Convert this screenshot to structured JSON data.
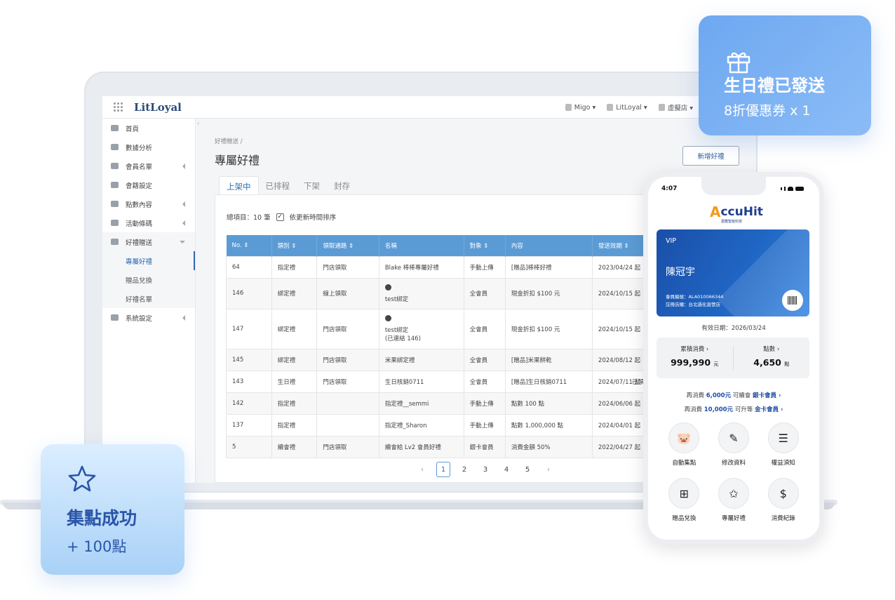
{
  "app": {
    "brand": "LitLoyal"
  },
  "topbar": {
    "items": [
      {
        "label": "Migo ▾",
        "icon": "building-icon"
      },
      {
        "label": "LitLoyal ▾",
        "icon": "star-icon"
      },
      {
        "label": "虛擬店 ▾",
        "icon": "store-icon"
      }
    ]
  },
  "sidebar": {
    "items": [
      {
        "label": "首頁",
        "icon": "dashboard-icon"
      },
      {
        "label": "數據分析",
        "icon": "chart-icon"
      },
      {
        "label": "會員名單",
        "icon": "users-icon"
      },
      {
        "label": "會籍設定",
        "icon": "user-icon"
      },
      {
        "label": "點數內容",
        "icon": "diamond-icon"
      },
      {
        "label": "活動條碼",
        "icon": "barcode-icon"
      },
      {
        "label": "好禮贈送",
        "icon": "gift-icon"
      },
      {
        "label": "系統設定",
        "icon": "gears-icon"
      }
    ],
    "sub": [
      "專屬好禮",
      "贈品兌換",
      "好禮名單"
    ]
  },
  "main": {
    "breadcrumb": "好禮贈送 /",
    "title": "專屬好禮",
    "add_button": "新增好禮",
    "tabs": [
      "上架中",
      "已排程",
      "下架",
      "封存"
    ],
    "total": "總項目：10 筆",
    "sort_label": "依更新時間排序",
    "table": {
      "headers": [
        "No. ⇕",
        "類別 ⇕",
        "領取通路 ⇕",
        "名稱",
        "對象 ⇕",
        "內容",
        "發送效期 ⇕"
      ],
      "rows": [
        [
          "64",
          "指定禮",
          "門店領取",
          "Blake 棒棒專屬好禮",
          "手動上傳",
          "[贈品]棒棒好禮",
          "2023/04/24 起"
        ],
        [
          "146",
          "綁定禮",
          "線上領取",
          "test綁定",
          "全會員",
          "現金折扣 $100 元",
          "2024/10/15 起"
        ],
        [
          "147",
          "綁定禮",
          "門店領取",
          "test綁定",
          "全會員",
          "現金折扣 $100 元",
          "2024/10/15 起"
        ],
        [
          "145",
          "綁定禮",
          "門店領取",
          "米果綁定禮",
          "全會員",
          "[贈品]米果餅乾",
          "2024/08/12 起"
        ],
        [
          "143",
          "生日禮",
          "門店領取",
          "生日核銷0711",
          "全會員",
          "[贈品]生日核銷0711",
          "2024/07/11 起"
        ],
        [
          "142",
          "指定禮",
          "",
          "指定禮__semmi",
          "手動上傳",
          "點數 100 點",
          "2024/06/06 起"
        ],
        [
          "137",
          "指定禮",
          "",
          "指定禮_Sharon",
          "手動上傳",
          "點數 1,000,000 點",
          "2024/04/01 起"
        ],
        [
          "5",
          "續會禮",
          "門店領取",
          "續會給 Lv2 會員好禮",
          "銀卡會員",
          "消費金額 50%",
          "2022/04/27 起"
        ]
      ],
      "extra_note": "(已連結 146)",
      "row5_trailing": "已領"
    },
    "pager": {
      "prev": "‹",
      "pages": [
        "1",
        "2",
        "3",
        "4",
        "5"
      ],
      "next": "›"
    }
  },
  "gift_card": {
    "title": "生日禮已發送",
    "subtitle": "8折優惠券 x 1"
  },
  "points_card": {
    "title": "集點成功",
    "subtitle": "+ 100點"
  },
  "phone": {
    "time": "4:07",
    "logo": "ccuHit",
    "logo_a": "A",
    "logo_sub": "愛酷智能科技",
    "card": {
      "level": "VIP",
      "name": "陳冠宇",
      "member_no": "會員編號：ALA010066344",
      "store": "註冊店櫃：台北過化直營店"
    },
    "valid": "有效日期：2026/03/24",
    "stats": [
      {
        "label": "累積消費 ›",
        "value": "999,990",
        "unit": "元"
      },
      {
        "label": "點數 ›",
        "value": "4,650",
        "unit": "點"
      }
    ],
    "upgrade": [
      {
        "pre": "再消費 ",
        "amount": "6,000元",
        "mid": " 可續會 ",
        "level": "銀卡會員",
        "arrow": " ›"
      },
      {
        "pre": "再消費 ",
        "amount": "10,000元",
        "mid": " 可升等 ",
        "level": "金卡會員",
        "arrow": " ›"
      }
    ],
    "actions": [
      {
        "label": "自動集點",
        "icon": "piggy-bank-icon",
        "glyph": "🐷"
      },
      {
        "label": "修改資料",
        "icon": "pencil-icon",
        "glyph": "✎"
      },
      {
        "label": "權益須知",
        "icon": "document-icon",
        "glyph": "☰"
      },
      {
        "label": "贈品兌換",
        "icon": "gift-box-icon",
        "glyph": "⊞"
      },
      {
        "label": "專屬好禮",
        "icon": "ticket-icon",
        "glyph": "✩"
      },
      {
        "label": "消費紀錄",
        "icon": "receipt-icon",
        "glyph": "$"
      }
    ]
  },
  "colors": {
    "accent": "#5b9bd5",
    "brand_blue": "#1e4ea6",
    "orange": "#f29a1e"
  }
}
